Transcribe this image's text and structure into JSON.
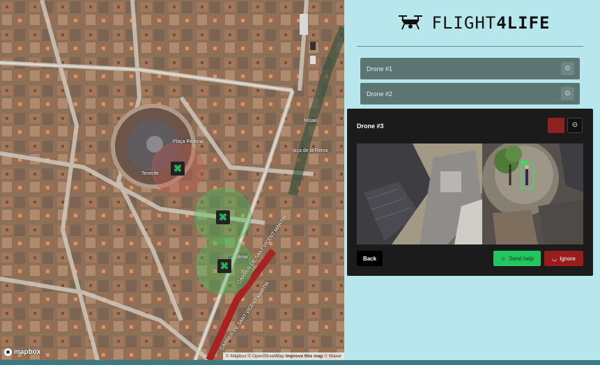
{
  "app": {
    "logo_text": "FLIGHT",
    "logo_accent": "4LIFE"
  },
  "map": {
    "labels": {
      "square": "Plaça Redona",
      "queen_square": "laça de la Reina",
      "pharmacy": "Tenerife",
      "street1": "CARRER DE SANT VICENT MARTIR",
      "street2": "CARRER DE SANT VICENT MARTIR",
      "poi1": "Misaki",
      "poi2": "dmar"
    },
    "logo": "mapbox",
    "attribution": {
      "prefix": "© Mapbox © OpenStreetMap",
      "improve": "Improve this map",
      "suffix": "© Maxar"
    }
  },
  "drones": [
    {
      "label": "Drone #1"
    },
    {
      "label": "Drone #2"
    }
  ],
  "detail": {
    "title": "Drone #3",
    "color": "#8e2020",
    "back_label": "Back",
    "help_label": "Send help",
    "ignore_label": "Ignore"
  },
  "icons": {
    "target": "crosshair-icon",
    "drone": "drone-icon"
  }
}
